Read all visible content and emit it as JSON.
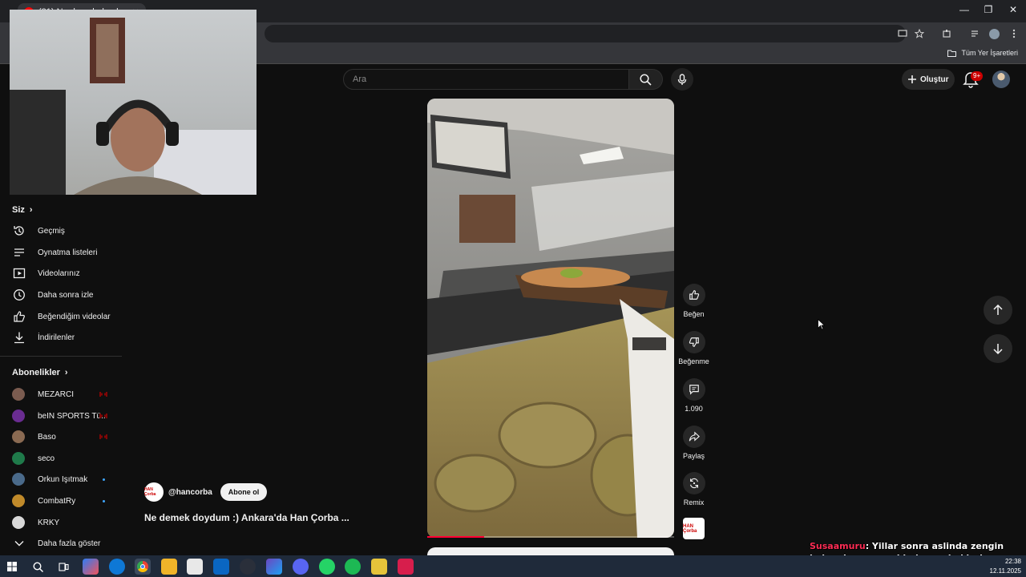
{
  "browser": {
    "tab_title": "(21) Ne demek doydum :) ...",
    "bookmarks_all_label": "Tüm Yer İşaretleri"
  },
  "header": {
    "search_placeholder": "Ara",
    "create_label": "Oluştur",
    "notification_badge": "9+"
  },
  "sidebar": {
    "you_heading": "Siz",
    "you_items": [
      {
        "label": "Geçmiş",
        "icon": "history-icon"
      },
      {
        "label": "Oynatma listeleri",
        "icon": "playlist-icon"
      },
      {
        "label": "Videolarınız",
        "icon": "your-videos-icon"
      },
      {
        "label": "Daha sonra izle",
        "icon": "watch-later-icon"
      },
      {
        "label": "Beğendiğim videolar",
        "icon": "liked-videos-icon"
      },
      {
        "label": "İndirilenler",
        "icon": "download-icon"
      }
    ],
    "subs_heading": "Abonelikler",
    "subscriptions": [
      {
        "label": "MEZARCI",
        "status": "live",
        "color": "#7a5b4f"
      },
      {
        "label": "beIN SPORTS Tü...",
        "status": "live",
        "color": "#6a2c91"
      },
      {
        "label": "Baso",
        "status": "live",
        "color": "#8a6a52"
      },
      {
        "label": "seco",
        "status": "none",
        "color": "#1f7a4a"
      },
      {
        "label": "Orkun Işıtmak",
        "status": "new",
        "color": "#4a6a8a"
      },
      {
        "label": "CombatRy",
        "status": "new",
        "color": "#c08a2a"
      },
      {
        "label": "KRKY",
        "status": "none",
        "color": "#d8d8d8"
      }
    ],
    "show_more_label": "Daha fazla göster"
  },
  "short": {
    "channel_handle": "@hancorba",
    "subscribe_label": "Abone ol",
    "title": "Ne demek doydum :) Ankara'da Han Çorba ...",
    "progress": 0.23,
    "actions": {
      "like": "Beğen",
      "dislike": "Beğenme",
      "comments": "1.090",
      "share": "Paylaş",
      "remix": "Remix"
    },
    "logo_text": "HAN Çorba"
  },
  "overlay": {
    "nick": "Susaamuru",
    "message": ": Yillar sonra aslinda zengin babami sans eseri bulmaya beklerken bizim hayaller"
  },
  "taskbar": {
    "time": "22:38",
    "date": "12.11.2025"
  },
  "colors": {
    "accent": "#ff0033",
    "background": "#0f0f0f",
    "live": "#cc0000",
    "new_dot": "#3ea6ff"
  }
}
